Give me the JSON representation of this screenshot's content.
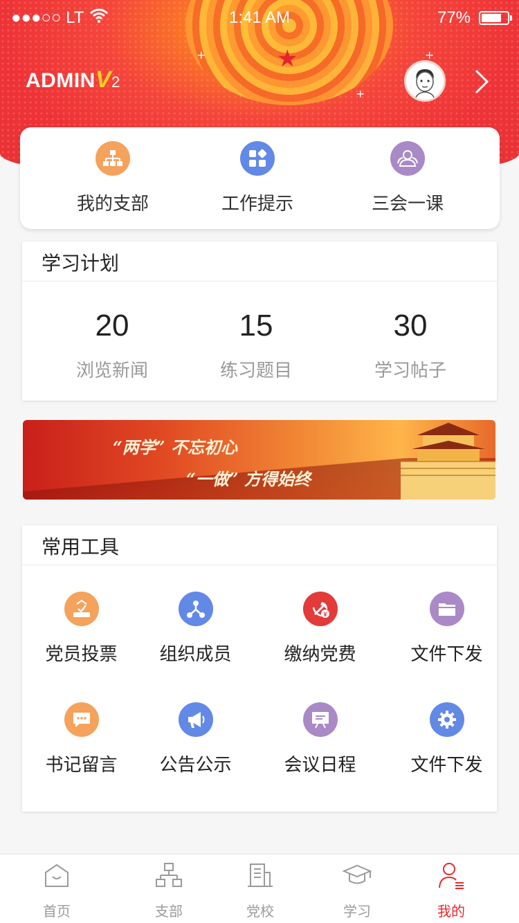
{
  "status_bar": {
    "carrier": "●●●○○ LT",
    "time": "1:41 AM",
    "battery_percent": "77%",
    "battery_level": 0.77
  },
  "header": {
    "logo_text": "ADMIN",
    "logo_v": "V",
    "logo_version": "2"
  },
  "quick_actions": [
    {
      "label": "我的支部",
      "icon": "org-chart-icon",
      "color": "#f5a25d"
    },
    {
      "label": "工作提示",
      "icon": "apps-grid-icon",
      "color": "#6289e6"
    },
    {
      "label": "三会一课",
      "icon": "meeting-people-icon",
      "color": "#a98ac6"
    }
  ],
  "study_plan": {
    "title": "学习计划",
    "stats": [
      {
        "value": "20",
        "label": "浏览新闻"
      },
      {
        "value": "15",
        "label": "练习题目"
      },
      {
        "value": "30",
        "label": "学习帖子"
      }
    ]
  },
  "banner": {
    "line1": "“两学” 不忘初心",
    "line2": "“一做” 方得始终"
  },
  "tools": {
    "title": "常用工具",
    "items": [
      {
        "label": "党员投票",
        "icon": "vote-icon",
        "color": "#f5a25d"
      },
      {
        "label": "组织成员",
        "icon": "share-nodes-icon",
        "color": "#6289e6"
      },
      {
        "label": "缴纳党费",
        "icon": "party-emblem-icon",
        "color": "#e33a3a"
      },
      {
        "label": "文件下发",
        "icon": "folder-icon",
        "color": "#a98ac6"
      },
      {
        "label": "书记留言",
        "icon": "chat-bubble-icon",
        "color": "#f5a25d"
      },
      {
        "label": "公告公示",
        "icon": "megaphone-icon",
        "color": "#6289e6"
      },
      {
        "label": "会议日程",
        "icon": "presentation-icon",
        "color": "#a98ac6"
      },
      {
        "label": "文件下发",
        "icon": "gear-icon",
        "color": "#6289e6"
      }
    ]
  },
  "tabbar": {
    "active_color": "#e8292d",
    "items": [
      {
        "label": "首页",
        "icon": "home-icon"
      },
      {
        "label": "支部",
        "icon": "branch-icon"
      },
      {
        "label": "党校",
        "icon": "building-icon"
      },
      {
        "label": "学习",
        "icon": "graduation-cap-icon"
      },
      {
        "label": "我的",
        "icon": "profile-icon"
      }
    ]
  }
}
